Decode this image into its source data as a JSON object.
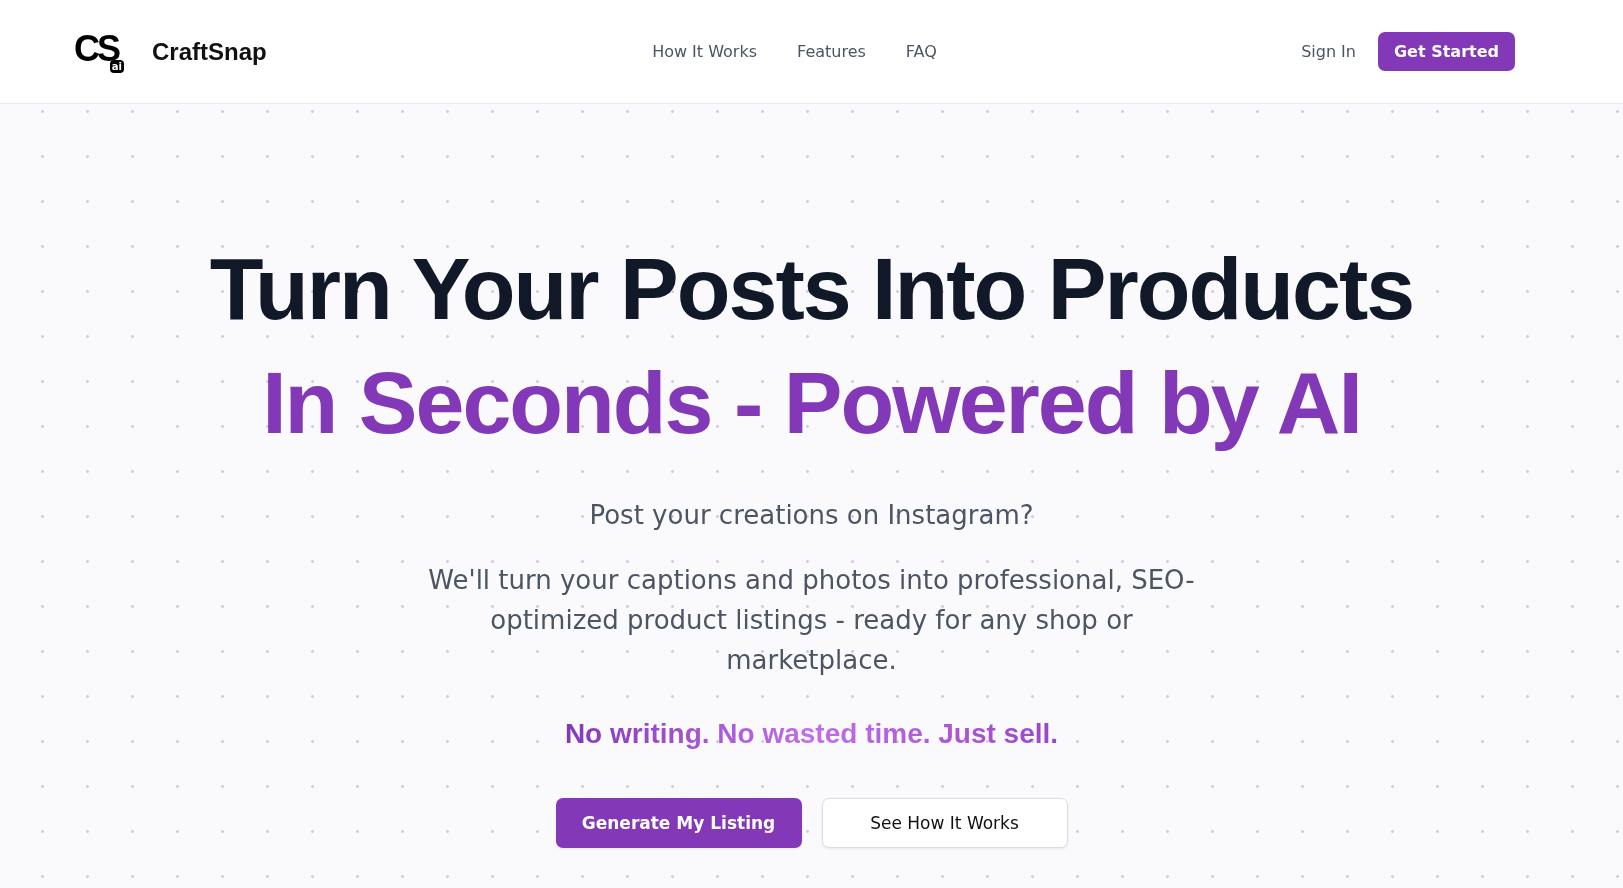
{
  "header": {
    "logo_mark": "CS",
    "logo_badge": "ai",
    "brand": "CraftSnap",
    "nav": [
      {
        "label": "How It Works"
      },
      {
        "label": "Features"
      },
      {
        "label": "FAQ"
      }
    ],
    "sign_in": "Sign In",
    "cta": "Get Started"
  },
  "hero": {
    "title_line_1": "Turn Your Posts Into Products",
    "title_line_2": "In Seconds - Powered by AI",
    "question": "Post your creations on Instagram?",
    "description": "We'll turn your captions and photos into professional, SEO-optimized product listings - ready for any shop or marketplace.",
    "tagline": "No writing. No wasted time. Just sell.",
    "buttons": [
      {
        "label": "Generate My Listing",
        "kind": "primary"
      },
      {
        "label": "See How It Works",
        "kind": "secondary"
      }
    ]
  }
}
